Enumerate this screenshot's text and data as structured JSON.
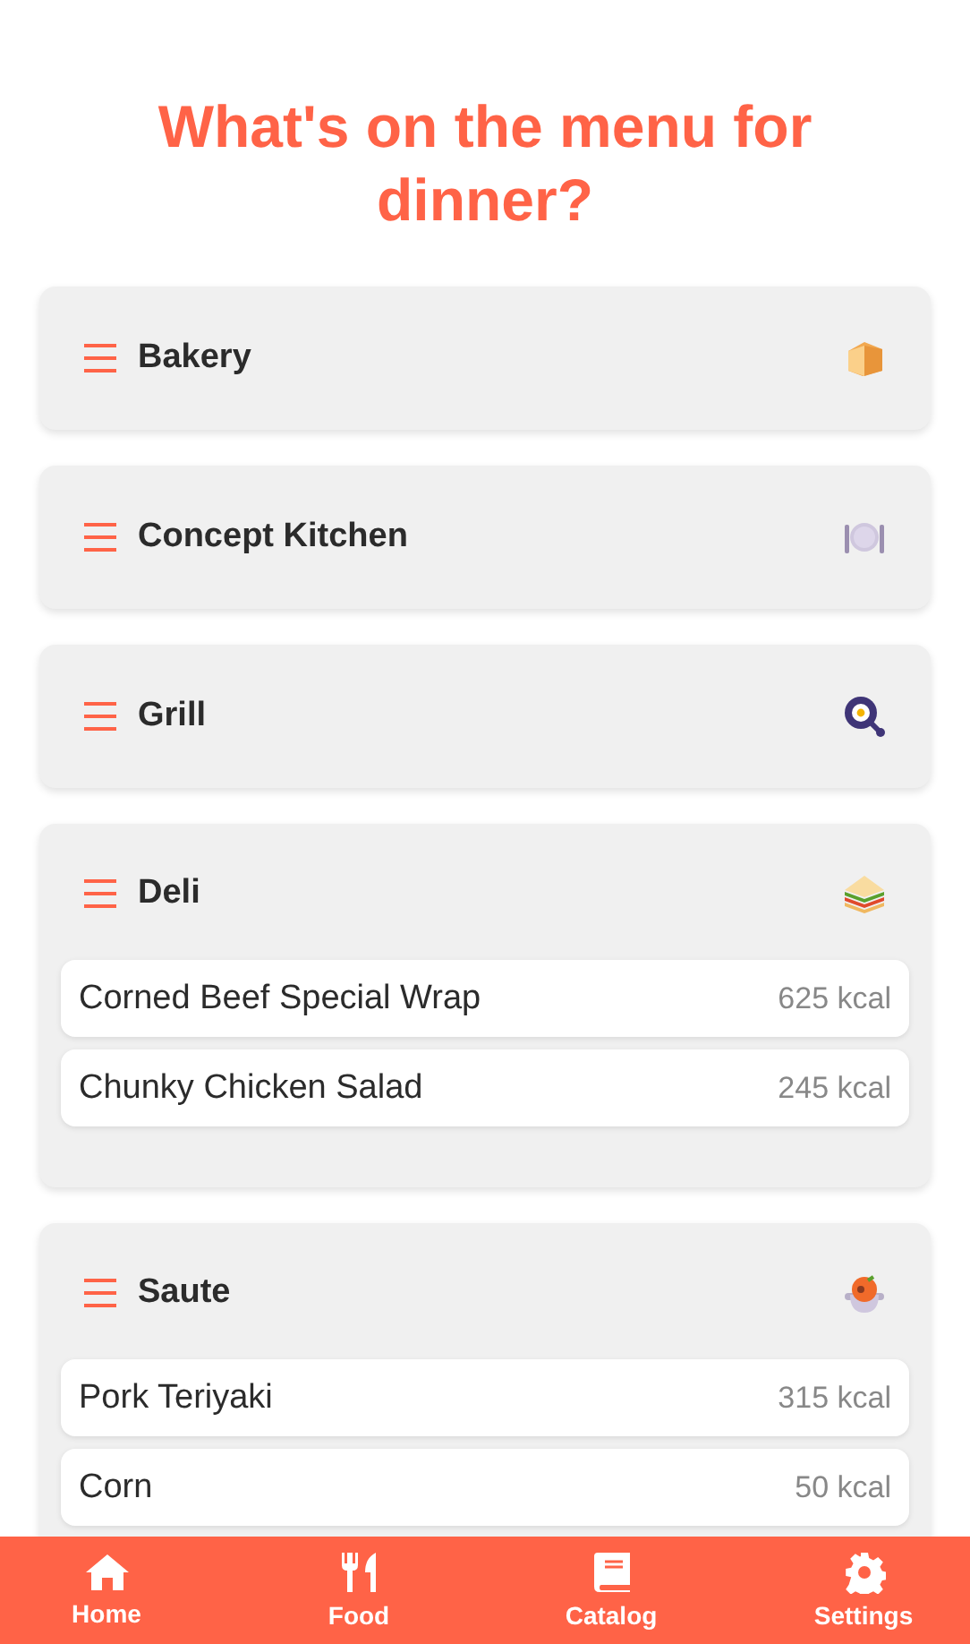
{
  "title": "What's on the menu for dinner?",
  "categories": [
    {
      "name": "Bakery",
      "expanded": false
    },
    {
      "name": "Concept Kitchen",
      "expanded": false
    },
    {
      "name": "Grill",
      "expanded": false
    },
    {
      "name": "Deli",
      "expanded": true,
      "items": [
        {
          "name": "Corned Beef Special Wrap",
          "calories": "625 kcal"
        },
        {
          "name": "Chunky Chicken Salad",
          "calories": "245 kcal"
        }
      ]
    },
    {
      "name": "Saute",
      "expanded": true,
      "items": [
        {
          "name": "Pork Teriyaki",
          "calories": "315 kcal"
        },
        {
          "name": "Corn",
          "calories": "50 kcal"
        }
      ]
    }
  ],
  "nav": [
    {
      "label": "Home",
      "kind": "home"
    },
    {
      "label": "Food",
      "kind": "food"
    },
    {
      "label": "Catalog",
      "kind": "catalog"
    },
    {
      "label": "Settings",
      "kind": "settings"
    }
  ]
}
